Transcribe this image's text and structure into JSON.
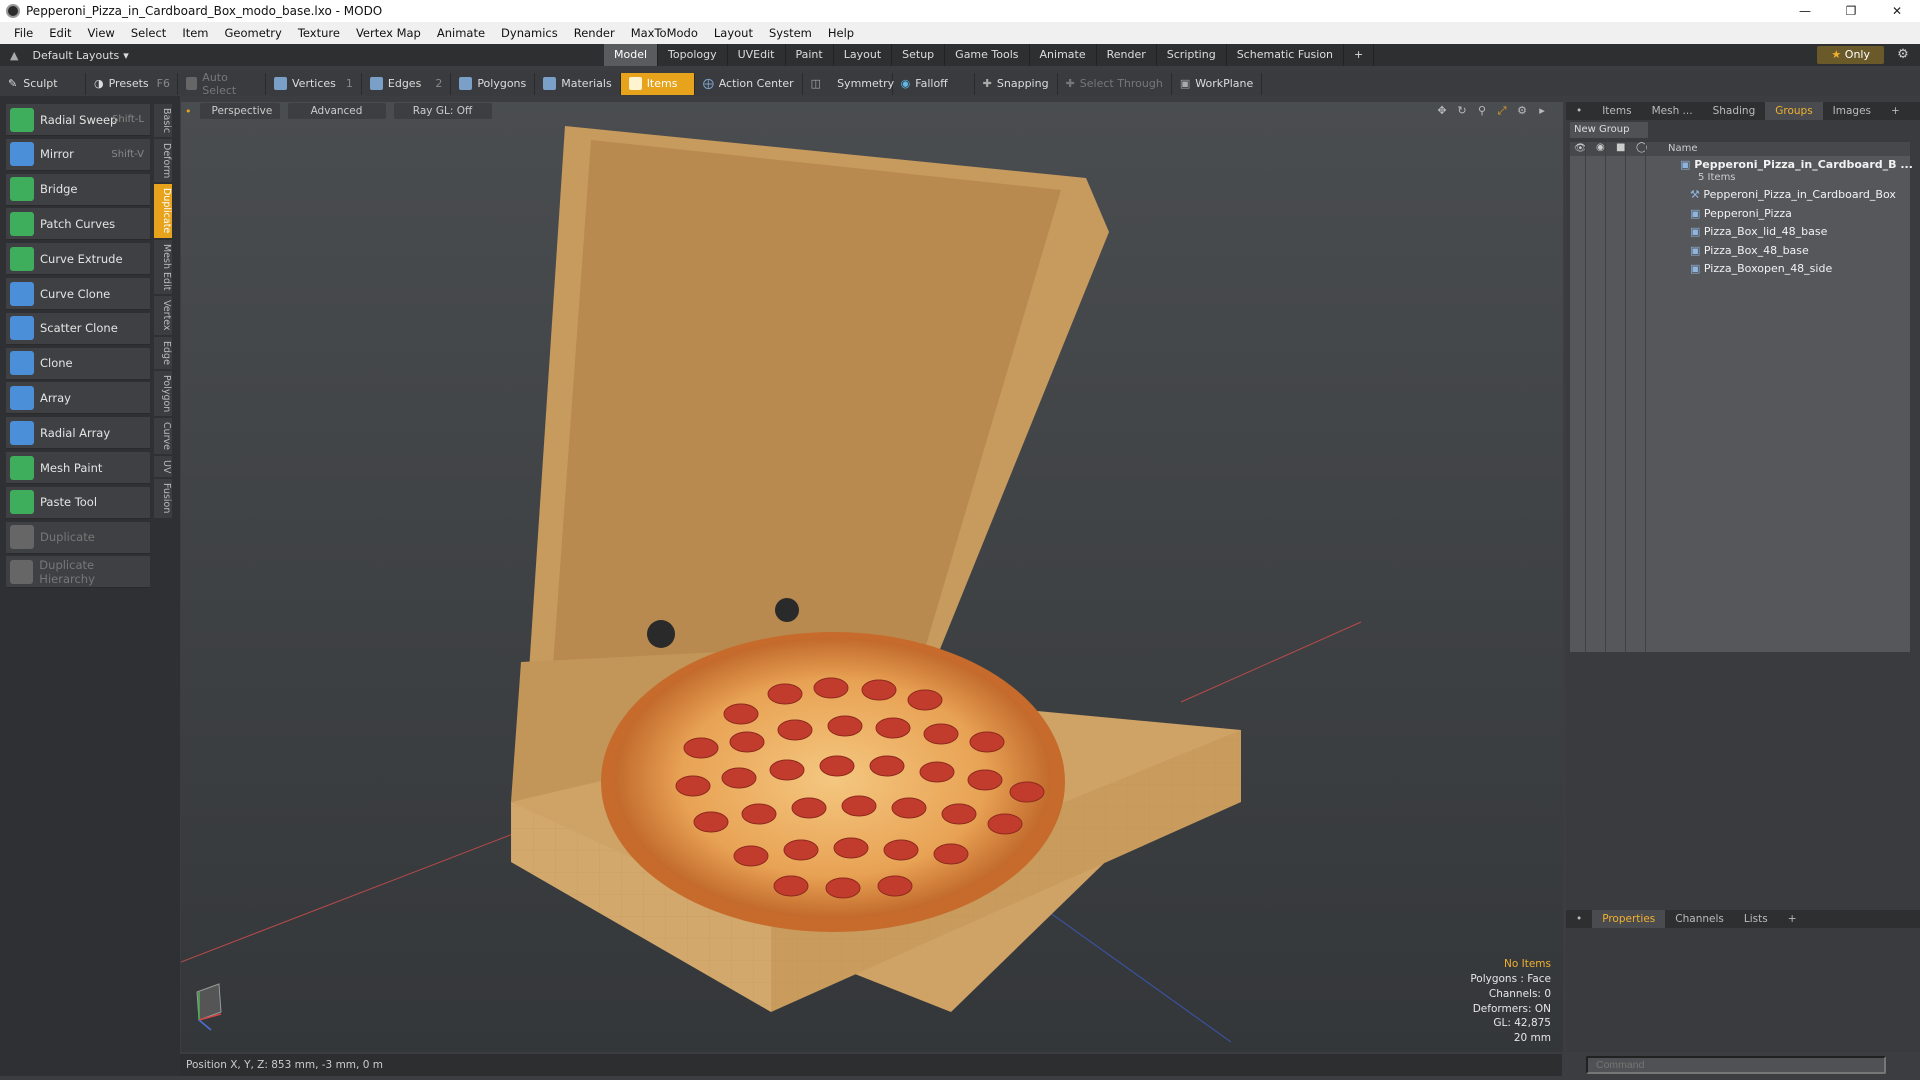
{
  "window": {
    "title": "Pepperoni_Pizza_in_Cardboard_Box_modo_base.lxo - MODO"
  },
  "menu": [
    "File",
    "Edit",
    "View",
    "Select",
    "Item",
    "Geometry",
    "Texture",
    "Vertex Map",
    "Animate",
    "Dynamics",
    "Render",
    "MaxToModo",
    "Layout",
    "System",
    "Help"
  ],
  "layout_selector": "Default Layouts",
  "layout_tabs": [
    {
      "label": "Model",
      "active": true
    },
    {
      "label": "Topology"
    },
    {
      "label": "UVEdit"
    },
    {
      "label": "Paint"
    },
    {
      "label": "Layout"
    },
    {
      "label": "Setup"
    },
    {
      "label": "Game Tools"
    },
    {
      "label": "Animate"
    },
    {
      "label": "Render"
    },
    {
      "label": "Scripting"
    },
    {
      "label": "Schematic Fusion"
    }
  ],
  "only_button": "Only",
  "toolbar": {
    "sculpt": "Sculpt",
    "presets": "Presets",
    "presets_key": "F6",
    "auto_select": "Auto Select",
    "vertices": "Vertices",
    "vertices_count": "1",
    "edges": "Edges",
    "edges_count": "2",
    "polygons": "Polygons",
    "materials": "Materials",
    "items": "Items",
    "action_center": "Action Center",
    "symmetry": "Symmetry",
    "falloff": "Falloff",
    "snapping": "Snapping",
    "select_through": "Select Through",
    "workplane": "WorkPlane"
  },
  "tools": [
    {
      "label": "Radial Sweep",
      "shortcut": "Shift-L",
      "color": "#3fae5c"
    },
    {
      "label": "Mirror",
      "shortcut": "Shift-V",
      "color": "#4b8fd8"
    },
    {
      "label": "Bridge",
      "shortcut": "",
      "color": "#3fae5c"
    },
    {
      "label": "Patch Curves",
      "shortcut": "",
      "color": "#3fae5c"
    },
    {
      "label": "Curve Extrude",
      "shortcut": "",
      "color": "#3fae5c"
    },
    {
      "label": "Curve Clone",
      "shortcut": "",
      "color": "#4b8fd8"
    },
    {
      "label": "Scatter Clone",
      "shortcut": "",
      "color": "#4b8fd8"
    },
    {
      "label": "Clone",
      "shortcut": "",
      "color": "#4b8fd8"
    },
    {
      "label": "Array",
      "shortcut": "",
      "color": "#4b8fd8"
    },
    {
      "label": "Radial Array",
      "shortcut": "",
      "color": "#4b8fd8"
    },
    {
      "label": "Mesh Paint",
      "shortcut": "",
      "color": "#3fae5c"
    },
    {
      "label": "Paste Tool",
      "shortcut": "",
      "color": "#3fae5c"
    },
    {
      "label": "Duplicate",
      "shortcut": "",
      "color": "#666666",
      "dim": true
    },
    {
      "label": "Duplicate Hierarchy",
      "shortcut": "",
      "color": "#666666",
      "dim": true
    }
  ],
  "side_tabs": [
    "Basic",
    "Deform",
    "Duplicate",
    "Mesh Edit",
    "Vertex",
    "Edge",
    "Polygon",
    "Curve",
    "UV",
    "Fusion"
  ],
  "active_side_tab": "Duplicate",
  "viewport": {
    "view_mode": "Perspective",
    "shading": "Advanced",
    "raygl": "Ray GL: Off"
  },
  "stats": {
    "selection": "No Items",
    "polygons": "Polygons : Face",
    "channels": "Channels: 0",
    "deformers": "Deformers: ON",
    "gl": "GL: 42,875",
    "scale": "20 mm"
  },
  "right_tabs": [
    {
      "label": "Items"
    },
    {
      "label": "Mesh ..."
    },
    {
      "label": "Shading"
    },
    {
      "label": "Groups",
      "active": true
    },
    {
      "label": "Images"
    }
  ],
  "groups": {
    "new_group": "New Group",
    "column_name": "Name",
    "root": "Pepperoni_Pizza_in_Cardboard_B ...",
    "count": "5 Items",
    "items": [
      "Pepperoni_Pizza_in_Cardboard_Box",
      "Pepperoni_Pizza",
      "Pizza_Box_lid_48_base",
      "Pizza_Box_48_base",
      "Pizza_Boxopen_48_side"
    ]
  },
  "bottom_tabs": [
    {
      "label": "Properties",
      "active": true
    },
    {
      "label": "Channels"
    },
    {
      "label": "Lists"
    }
  ],
  "status": {
    "position": "Position X, Y, Z:  853 mm, -3 mm, 0 m"
  },
  "command_placeholder": "Command"
}
